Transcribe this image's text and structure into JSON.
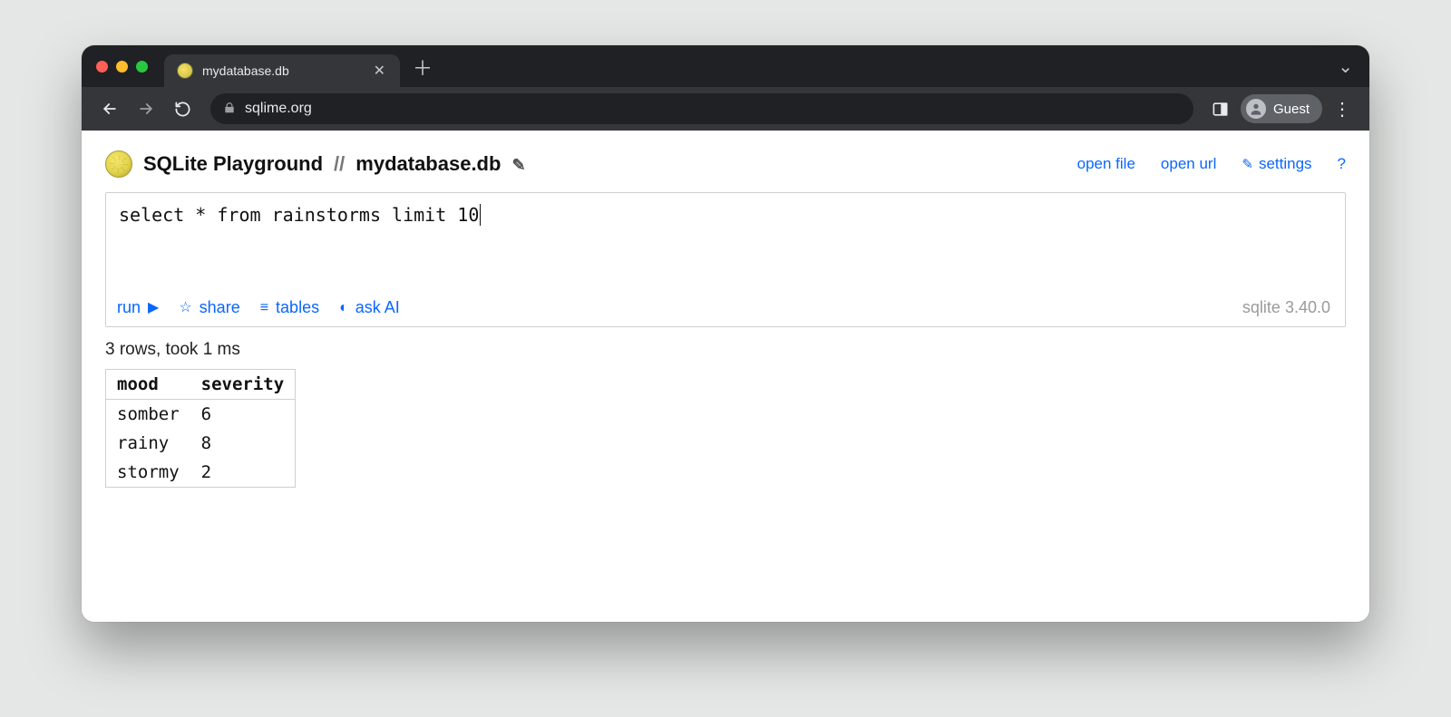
{
  "browser": {
    "tab_title": "mydatabase.db",
    "url_display": "sqlime.org",
    "guest_label": "Guest"
  },
  "header": {
    "app_title": "SQLite Playground",
    "separator": "//",
    "db_name": "mydatabase.db",
    "links": {
      "open_file": "open file",
      "open_url": "open url",
      "settings": "settings",
      "help": "?"
    }
  },
  "editor": {
    "query": "select * from rainstorms limit 10",
    "actions": {
      "run": "run",
      "share": "share",
      "tables": "tables",
      "ask_ai": "ask AI"
    },
    "version": "sqlite 3.40.0"
  },
  "results": {
    "status": "3 rows, took 1 ms",
    "columns": [
      "mood",
      "severity"
    ],
    "rows": [
      [
        "somber",
        "6"
      ],
      [
        "rainy",
        "8"
      ],
      [
        "stormy",
        "2"
      ]
    ]
  }
}
